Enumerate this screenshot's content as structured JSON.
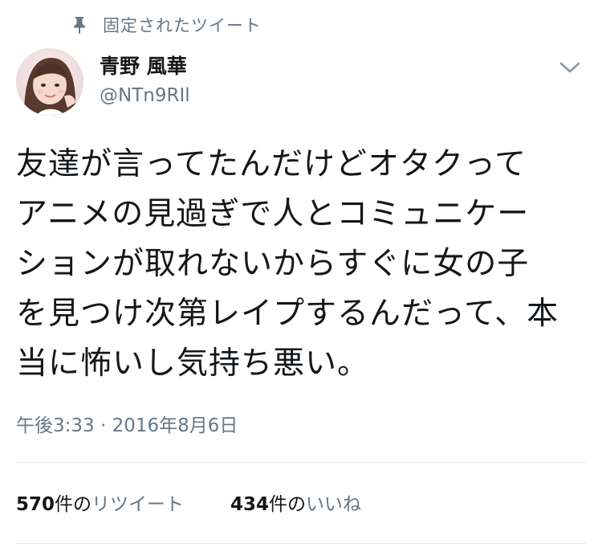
{
  "pinned": {
    "icon": "pin-icon",
    "label": "固定されたツイート"
  },
  "user": {
    "display_name": "青野 風華",
    "handle": "@NTn9RIl",
    "avatar_icon": "avatar-photo"
  },
  "menu": {
    "icon": "chevron-down-icon"
  },
  "tweet": {
    "text": "友達が言ってたんだけどオタクって\nアニメの見過ぎで人とコミュニケー\nションが取れないからすぐに女の子\nを見つけ次第レイプするんだって、本\n当に怖いし気持ち悪い。",
    "timestamp": "午後3:33 · 2016年8月6日"
  },
  "stats": {
    "retweets": {
      "count": "570",
      "unit": "件の",
      "label": "リツイート"
    },
    "likes": {
      "count": "434",
      "unit": "件の",
      "label": "いいね"
    }
  },
  "colors": {
    "text": "#14171a",
    "secondary": "#657786",
    "divider": "#e1e8ed"
  }
}
